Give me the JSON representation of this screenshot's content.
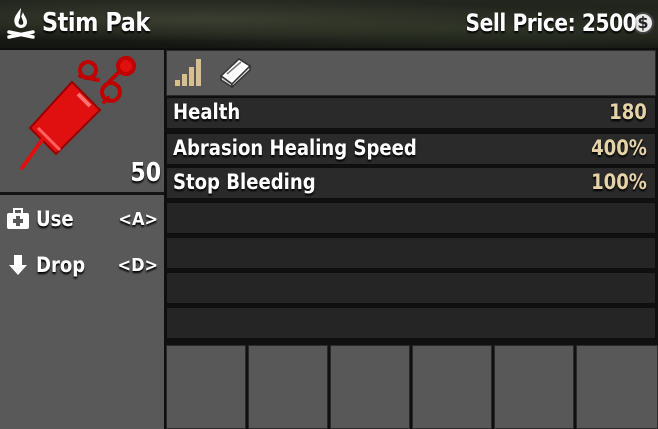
{
  "header": {
    "title": "Stim Pak",
    "sell_price": "Sell Price: 2500",
    "coin_symbol": "$",
    "title_icon": "campfire-icon",
    "coin_icon": "dollar-coin-icon"
  },
  "item": {
    "icon": "syringe-icon",
    "icon_color": "#e01010",
    "count": "50"
  },
  "actions": [
    {
      "label": "Use",
      "key": "<A>",
      "icon": "medkit-icon"
    },
    {
      "label": "Drop",
      "key": "<D>",
      "icon": "down-arrow-icon"
    }
  ],
  "info_icons": [
    "quality-bars-icon",
    "book-icon"
  ],
  "stats": [
    {
      "name": "Health",
      "value": "180"
    },
    {
      "name": "Abrasion Healing Speed",
      "value": "400%"
    },
    {
      "name": "Stop Bleeding",
      "value": "100%"
    }
  ],
  "colors": {
    "stat_value": "#e6d3a8",
    "panel": "#585858",
    "row": "#2a2a2a"
  }
}
